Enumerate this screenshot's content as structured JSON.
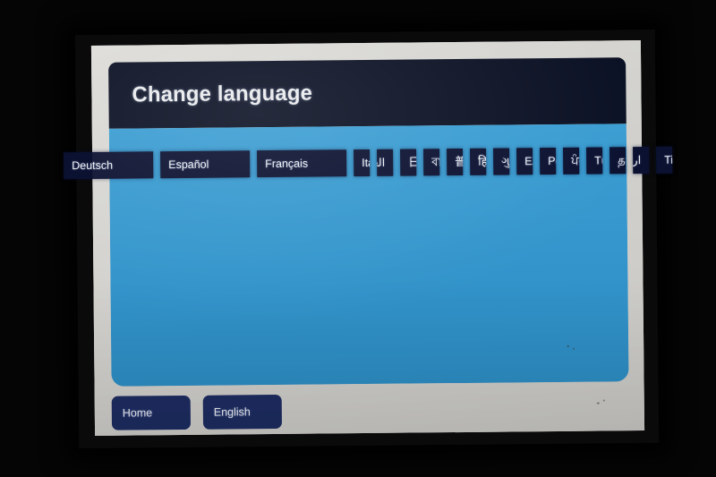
{
  "screen": {
    "title": "Change language"
  },
  "languages": [
    {
      "label": "Deutsch",
      "dir": "ltr",
      "script": "latin"
    },
    {
      "label": "Español",
      "dir": "ltr",
      "script": "latin"
    },
    {
      "label": "Français",
      "dir": "ltr",
      "script": "latin"
    },
    {
      "label": "Italiano",
      "dir": "ltr",
      "script": "latin"
    },
    {
      "label": "العربية",
      "dir": "rtl",
      "script": "arabic"
    },
    {
      "label": "日本語",
      "dir": "ltr",
      "script": "cjk"
    },
    {
      "label": "বাংলা",
      "dir": "ltr",
      "script": "indic"
    },
    {
      "label": "普通话",
      "dir": "ltr",
      "script": "cjk"
    },
    {
      "label": "हिन्दी",
      "dir": "ltr",
      "script": "indic"
    },
    {
      "label": "ગુજરાતી",
      "dir": "ltr",
      "script": "indic"
    },
    {
      "label": "Ελληνικά",
      "dir": "ltr",
      "script": "latin"
    },
    {
      "label": "Polski",
      "dir": "ltr",
      "script": "latin"
    },
    {
      "label": "ਪੰਜਾਬੀ",
      "dir": "ltr",
      "script": "indic"
    },
    {
      "label": "Türkçe",
      "dir": "ltr",
      "script": "latin"
    },
    {
      "label": "தமிழ்",
      "dir": "ltr",
      "script": "indic"
    },
    {
      "label": "اردو",
      "dir": "rtl",
      "script": "arabic"
    },
    {
      "label": "Tiếng Việt",
      "dir": "ltr",
      "script": "latin"
    }
  ],
  "footer": {
    "home_label": "Home",
    "language_label": "English"
  },
  "colors": {
    "header_navy": "#0b1124",
    "panel_blue": "#3496cc",
    "button_navy": "#0b1130",
    "footer_button_navy": "#1d2c61",
    "screen_grey": "#d4d3cf",
    "text_white": "#f0f1f4"
  }
}
